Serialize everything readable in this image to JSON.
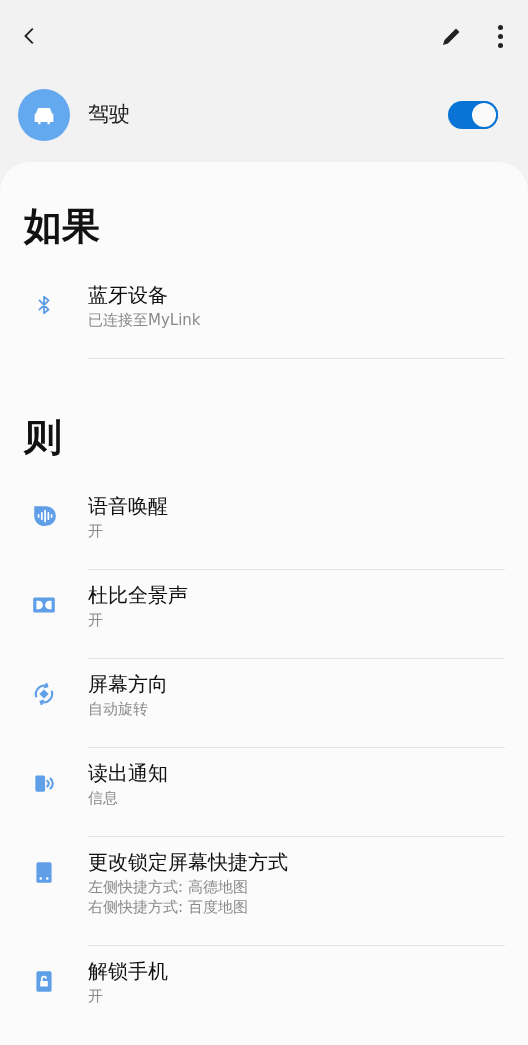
{
  "header": {
    "title": "驾驶",
    "enabled": true
  },
  "sections": [
    {
      "heading": "如果",
      "items": [
        {
          "title": "蓝牙设备",
          "subtitles": [
            "已连接至MyLink"
          ]
        }
      ]
    },
    {
      "heading": "则",
      "items": [
        {
          "title": "语音唤醒",
          "subtitles": [
            "开"
          ]
        },
        {
          "title": "杜比全景声",
          "subtitles": [
            "开"
          ]
        },
        {
          "title": "屏幕方向",
          "subtitles": [
            "自动旋转"
          ]
        },
        {
          "title": "读出通知",
          "subtitles": [
            "信息"
          ]
        },
        {
          "title": "更改锁定屏幕快捷方式",
          "subtitles": [
            "左侧快捷方式: 高德地图",
            "右侧快捷方式: 百度地图"
          ]
        },
        {
          "title": "解锁手机",
          "subtitles": [
            "开"
          ]
        }
      ]
    }
  ]
}
